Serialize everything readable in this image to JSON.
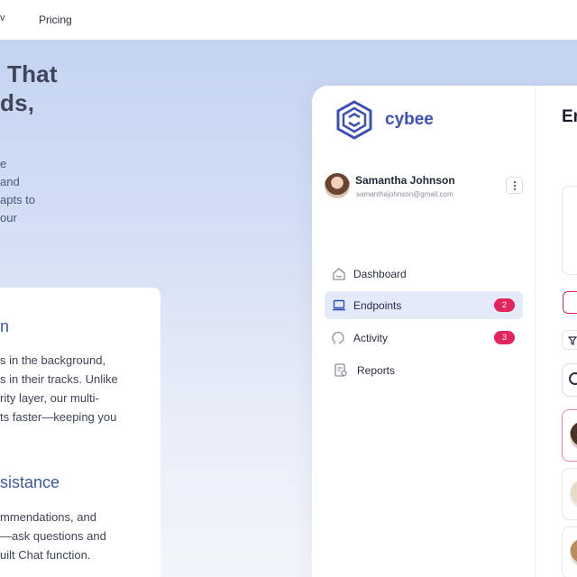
{
  "topnav": {
    "chevron": "v",
    "pricing": "Pricing"
  },
  "hero": {
    "headline_line1": "That",
    "headline_line2": "ds,",
    "desc_lines": [
      "e",
      "and",
      "apts to",
      "our"
    ]
  },
  "features": [
    {
      "title": "n",
      "body_lines": [
        "s in the background,",
        "s in their tracks. Unlike",
        "rity layer, our multi-",
        "ts faster—keeping you"
      ]
    },
    {
      "title": "sistance",
      "body_lines": [
        "mmendations, and",
        "—ask questions and",
        "uilt Chat function."
      ]
    }
  ],
  "app": {
    "logo_text": "cybee",
    "user": {
      "name": "Samantha Johnson",
      "email": "samanthajohnson@gmail.com"
    },
    "nav": [
      {
        "label": "Dashboard",
        "icon": "home-icon",
        "badge": null,
        "active": false
      },
      {
        "label": "Endpoints",
        "icon": "laptop-icon",
        "badge": "2",
        "active": true
      },
      {
        "label": "Activity",
        "icon": "activity-icon",
        "badge": "3",
        "active": false
      },
      {
        "label": "Reports",
        "icon": "reports-icon",
        "badge": null,
        "active": false
      }
    ],
    "main_title": "En"
  },
  "colors": {
    "accent": "#3d4fb8",
    "badge": "#e2245f",
    "active_nav": "#e4eaf7"
  }
}
